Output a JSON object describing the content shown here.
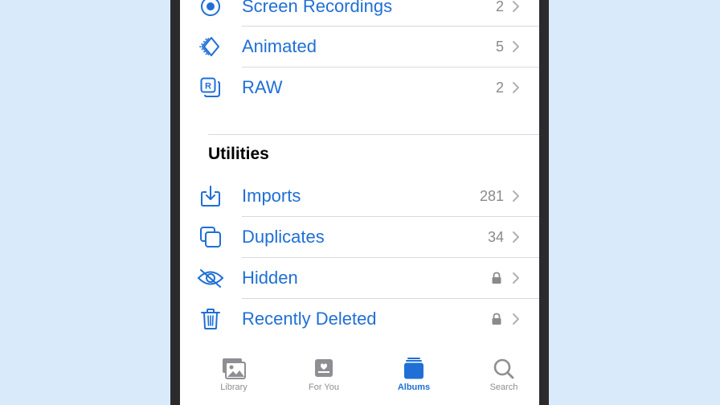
{
  "media_types": [
    {
      "label": "Screen Recordings",
      "count": "2",
      "icon": "screen-recording-icon"
    },
    {
      "label": "Animated",
      "count": "5",
      "icon": "animated-icon"
    },
    {
      "label": "RAW",
      "count": "2",
      "icon": "raw-icon"
    }
  ],
  "utilities": {
    "title": "Utilities",
    "items": [
      {
        "label": "Imports",
        "count": "281",
        "icon": "import-icon"
      },
      {
        "label": "Duplicates",
        "count": "34",
        "icon": "duplicates-icon"
      },
      {
        "label": "Hidden",
        "locked": true,
        "icon": "hidden-eye-icon"
      },
      {
        "label": "Recently Deleted",
        "locked": true,
        "icon": "trash-icon"
      }
    ]
  },
  "tabbar": {
    "tabs": [
      {
        "label": "Library",
        "icon": "library-icon"
      },
      {
        "label": "For You",
        "icon": "for-you-icon"
      },
      {
        "label": "Albums",
        "icon": "albums-icon",
        "active": true
      },
      {
        "label": "Search",
        "icon": "search-icon"
      }
    ]
  },
  "colors": {
    "accent": "#1f6fd6",
    "secondary": "#8a8a8e",
    "background": "#d9eafb"
  }
}
